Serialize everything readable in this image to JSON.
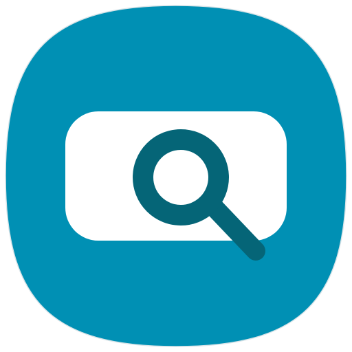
{
  "app_icon": {
    "icon_name": "search-app-icon",
    "background_color": "#0090b4",
    "card_color": "#ffffff",
    "magnifier_color": "#056577"
  }
}
